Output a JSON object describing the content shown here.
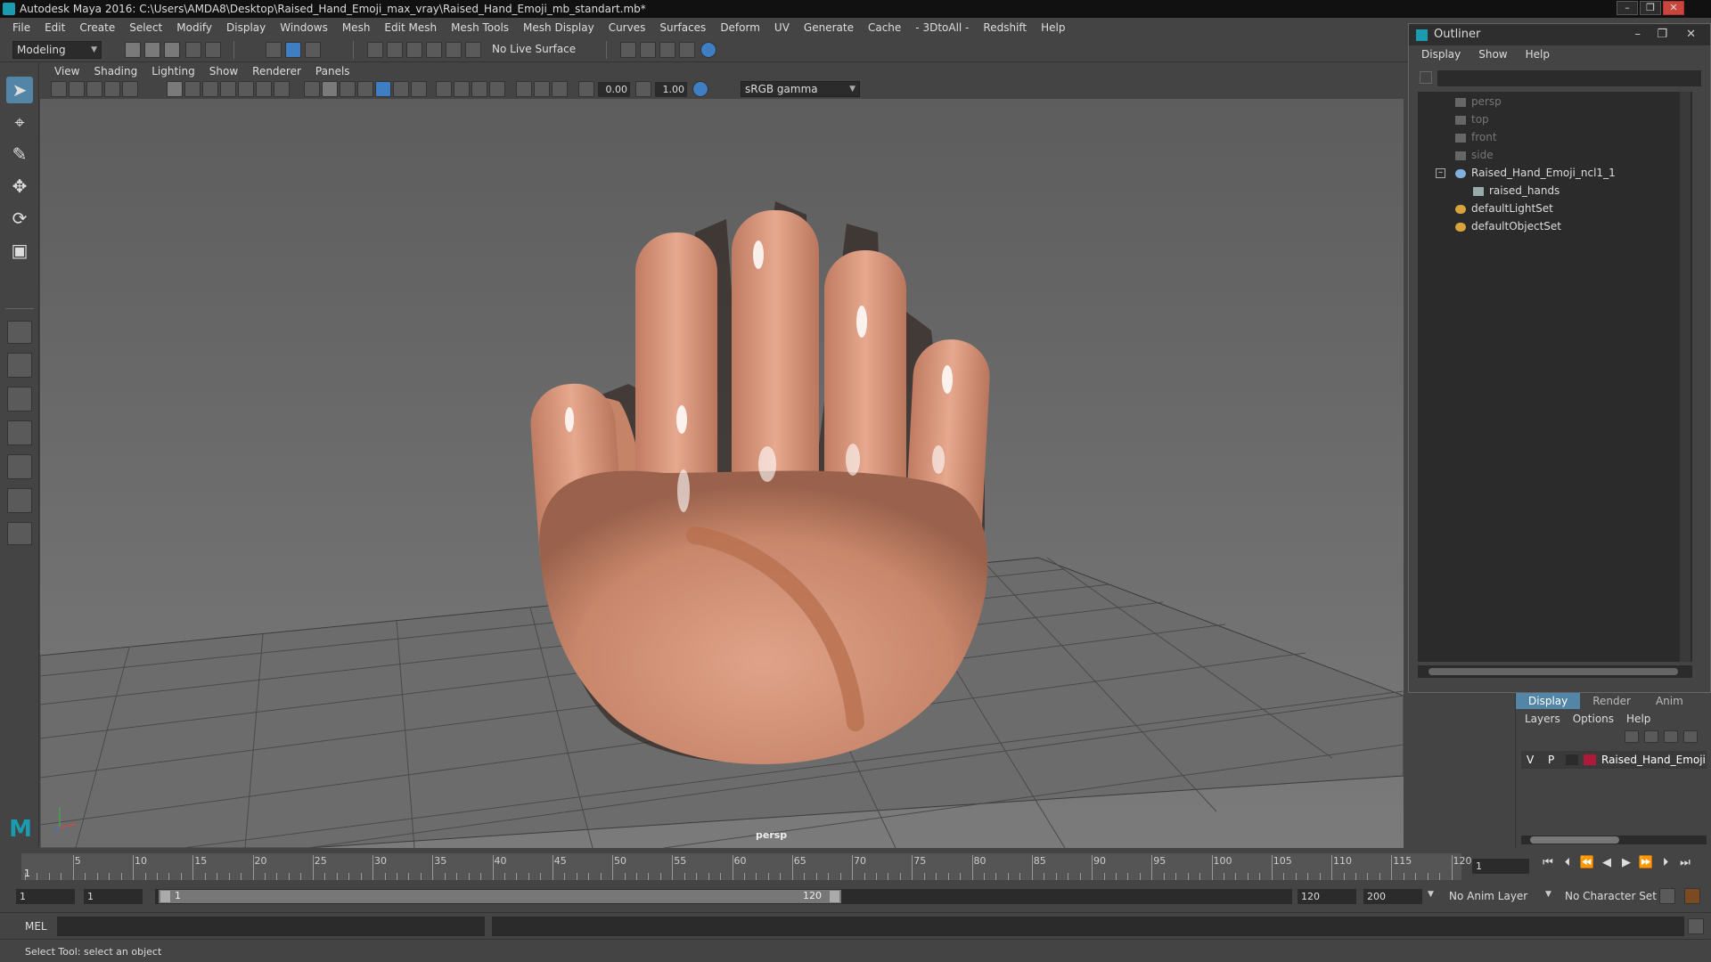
{
  "window": {
    "title": "Autodesk Maya 2016: C:\\Users\\AMDA8\\Desktop\\Raised_Hand_Emoji_max_vray\\Raised_Hand_Emoji_mb_standart.mb*"
  },
  "menubar": [
    "File",
    "Edit",
    "Create",
    "Select",
    "Modify",
    "Display",
    "Windows",
    "Mesh",
    "Edit Mesh",
    "Mesh Tools",
    "Mesh Display",
    "Curves",
    "Surfaces",
    "Deform",
    "UV",
    "Generate",
    "Cache",
    "- 3DtoAll -",
    "Redshift",
    "Help"
  ],
  "statusline": {
    "menuset": "Modeling",
    "live_surface": "No Live Surface"
  },
  "panel": {
    "menu": [
      "View",
      "Shading",
      "Lighting",
      "Show",
      "Renderer",
      "Panels"
    ],
    "exposure": "0.00",
    "gamma": "1.00",
    "color_space": "sRGB gamma",
    "camera_label": "persp"
  },
  "outliner": {
    "title": "Outliner",
    "menu": [
      "Display",
      "Show",
      "Help"
    ],
    "nodes": [
      {
        "label": "persp",
        "dim": true,
        "icon": "camera-icon"
      },
      {
        "label": "top",
        "dim": true,
        "icon": "camera-icon"
      },
      {
        "label": "front",
        "dim": true,
        "icon": "camera-icon"
      },
      {
        "label": "side",
        "dim": true,
        "icon": "camera-icon"
      },
      {
        "label": "Raised_Hand_Emoji_ncl1_1",
        "dim": false,
        "icon": "group-icon",
        "expanded": true
      },
      {
        "label": "raised_hands",
        "dim": false,
        "icon": "mesh-icon",
        "child": true
      },
      {
        "label": "defaultLightSet",
        "dim": false,
        "icon": "set-icon"
      },
      {
        "label": "defaultObjectSet",
        "dim": false,
        "icon": "set-icon"
      }
    ]
  },
  "layers": {
    "tabs": [
      "Display",
      "Render",
      "Anim"
    ],
    "active_tab": "Display",
    "menu": [
      "Layers",
      "Options",
      "Help"
    ],
    "rows": [
      {
        "v": "V",
        "p": "P",
        "name": "Raised_Hand_Emoji",
        "color": "#b01a3a"
      }
    ]
  },
  "timeline": {
    "ticks": [
      "5",
      "10",
      "15",
      "20",
      "25",
      "30",
      "35",
      "40",
      "45",
      "50",
      "55",
      "60",
      "65",
      "70",
      "75",
      "80",
      "85",
      "90",
      "95",
      "100",
      "105",
      "110",
      "115",
      "120"
    ],
    "start_label": "1",
    "current_frame": "1"
  },
  "range": {
    "start": "1",
    "playback_start": "1",
    "slider_start": "1",
    "slider_end": "120",
    "playback_end": "120",
    "end": "200",
    "anim_layer": "No Anim Layer",
    "character_set": "No Character Set"
  },
  "command": {
    "lang": "MEL"
  },
  "help": {
    "text": "Select Tool: select an object"
  }
}
